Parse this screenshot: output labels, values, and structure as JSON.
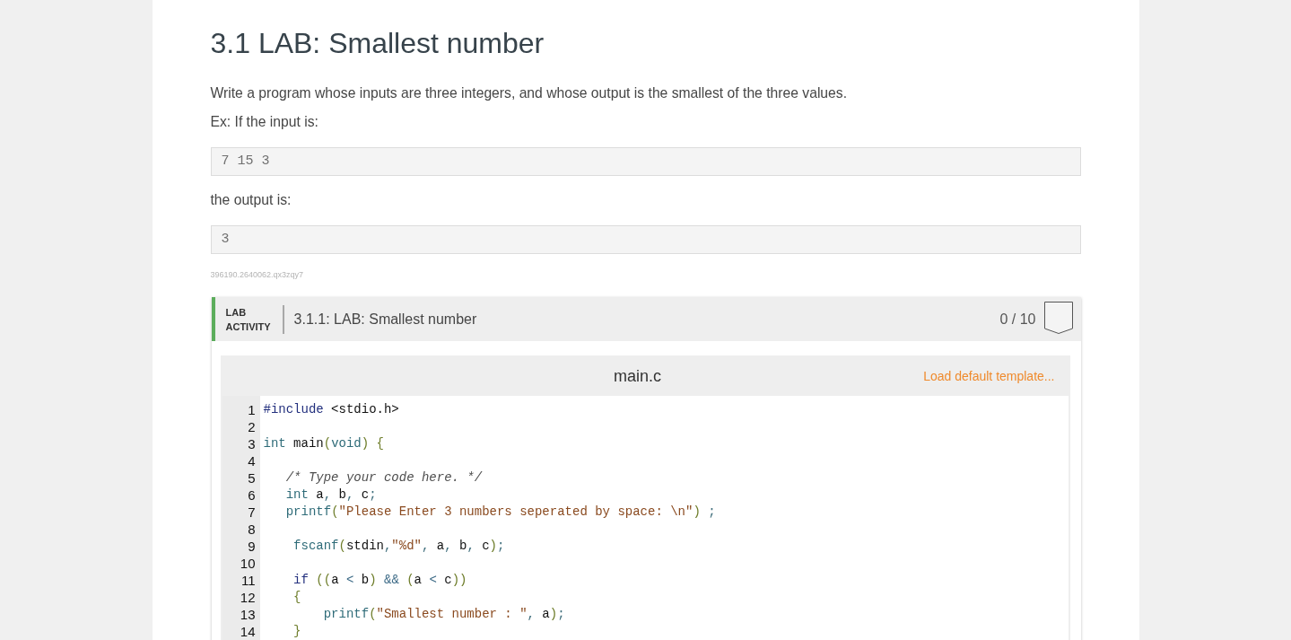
{
  "page": {
    "title": "3.1 LAB: Smallest number"
  },
  "instructions": [
    {
      "kind": "text",
      "text": "Write a program whose inputs are three integers, and whose output is the smallest of the three values."
    },
    {
      "kind": "text",
      "text": "Ex: If the input is:"
    },
    {
      "kind": "sample",
      "text": "7 15 3"
    },
    {
      "kind": "text",
      "text": "the output is:"
    },
    {
      "kind": "sample",
      "text": "3"
    }
  ],
  "content_id": "396190.2640062.qx3zqy7",
  "lab_activity": {
    "label": "LAB ACTIVITY",
    "title": "3.1.1: LAB: Smallest number",
    "score": "0 / 10"
  },
  "editor": {
    "file_name": "main.c",
    "template_link": "Load default template...",
    "lines": [
      {
        "number": "1",
        "tokens": [
          {
            "kind": "directive",
            "text": "#include"
          },
          {
            "kind": "plain",
            "text": " <stdio.h>"
          }
        ]
      },
      {
        "number": "2"
      },
      {
        "number": "3",
        "tokens": [
          {
            "kind": "type",
            "text": "int"
          },
          {
            "kind": "plain",
            "text": " main"
          },
          {
            "kind": "paren",
            "text": "("
          },
          {
            "kind": "type",
            "text": "void"
          },
          {
            "kind": "paren",
            "text": ") {"
          }
        ]
      },
      {
        "number": "4"
      },
      {
        "number": "5",
        "tokens": [
          {
            "kind": "comment",
            "text": "   /* Type your code here. */"
          }
        ]
      },
      {
        "number": "6",
        "tokens": [
          {
            "kind": "type",
            "text": "   int"
          },
          {
            "kind": "plain",
            "text": " a"
          },
          {
            "kind": "punct",
            "text": ","
          },
          {
            "kind": "plain",
            "text": " b"
          },
          {
            "kind": "punct",
            "text": ","
          },
          {
            "kind": "plain",
            "text": " c"
          },
          {
            "kind": "punct",
            "text": ";"
          }
        ]
      },
      {
        "number": "7",
        "tokens": [
          {
            "kind": "func",
            "text": "   printf"
          },
          {
            "kind": "paren",
            "text": "("
          },
          {
            "kind": "string",
            "text": "\"Please Enter 3 numbers seperated by space: \\n\""
          },
          {
            "kind": "paren",
            "text": ")"
          },
          {
            "kind": "punct",
            "text": " ;"
          }
        ]
      },
      {
        "number": "8"
      },
      {
        "number": "9",
        "tokens": [
          {
            "kind": "func",
            "text": "    fscanf"
          },
          {
            "kind": "paren",
            "text": "("
          },
          {
            "kind": "plain",
            "text": "stdin"
          },
          {
            "kind": "punct",
            "text": ","
          },
          {
            "kind": "string",
            "text": "\"%d\""
          },
          {
            "kind": "punct",
            "text": ","
          },
          {
            "kind": "plain",
            "text": " a"
          },
          {
            "kind": "punct",
            "text": ","
          },
          {
            "kind": "plain",
            "text": " b"
          },
          {
            "kind": "punct",
            "text": ","
          },
          {
            "kind": "plain",
            "text": " c"
          },
          {
            "kind": "paren",
            "text": ")"
          },
          {
            "kind": "punct",
            "text": ";"
          }
        ]
      },
      {
        "number": "10"
      },
      {
        "number": "11",
        "tokens": [
          {
            "kind": "keyword",
            "text": "    if"
          },
          {
            "kind": "paren",
            "text": " (("
          },
          {
            "kind": "plain",
            "text": "a "
          },
          {
            "kind": "op",
            "text": "<"
          },
          {
            "kind": "plain",
            "text": " b"
          },
          {
            "kind": "paren",
            "text": ")"
          },
          {
            "kind": "op",
            "text": " &&"
          },
          {
            "kind": "paren",
            "text": " ("
          },
          {
            "kind": "plain",
            "text": "a "
          },
          {
            "kind": "op",
            "text": "<"
          },
          {
            "kind": "plain",
            "text": " c"
          },
          {
            "kind": "paren",
            "text": "))"
          }
        ]
      },
      {
        "number": "12",
        "tokens": [
          {
            "kind": "paren",
            "text": "    {"
          }
        ]
      },
      {
        "number": "13",
        "tokens": [
          {
            "kind": "func",
            "text": "        printf"
          },
          {
            "kind": "paren",
            "text": "("
          },
          {
            "kind": "string",
            "text": "\"Smallest number : \""
          },
          {
            "kind": "punct",
            "text": ","
          },
          {
            "kind": "plain",
            "text": " a"
          },
          {
            "kind": "paren",
            "text": ")"
          },
          {
            "kind": "punct",
            "text": ";"
          }
        ]
      },
      {
        "number": "14",
        "tokens": [
          {
            "kind": "paren",
            "text": "    }"
          }
        ]
      }
    ]
  }
}
